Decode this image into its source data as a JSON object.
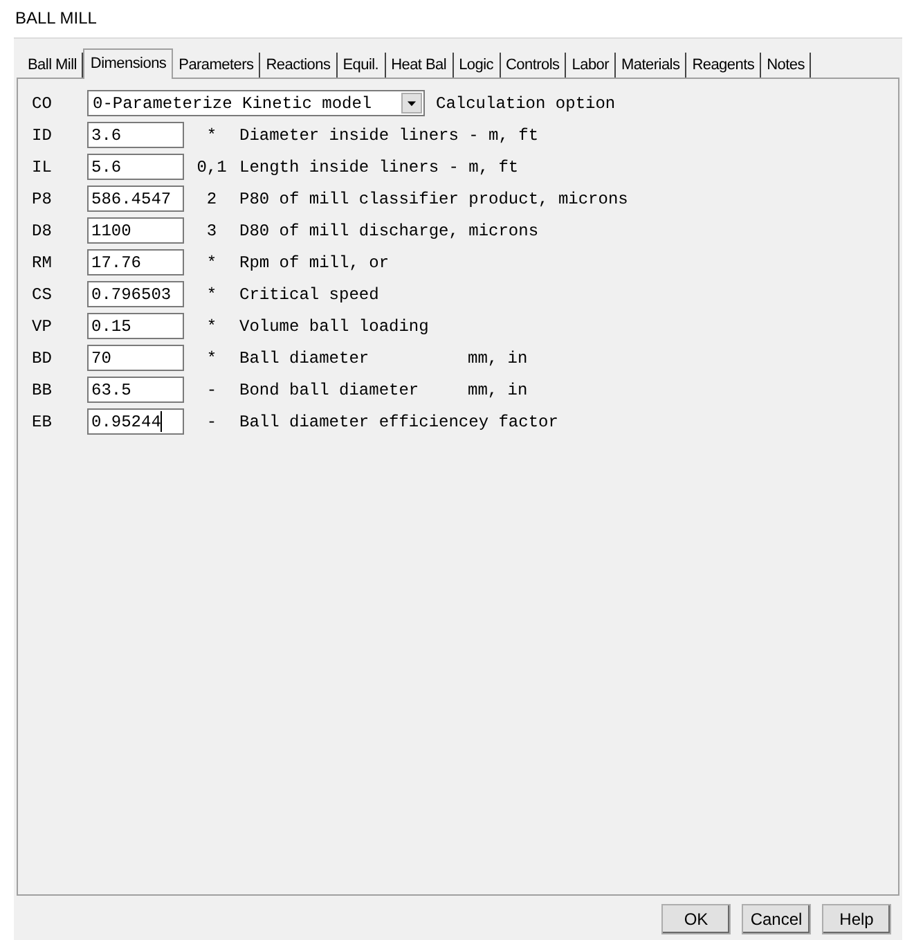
{
  "window": {
    "title": "BALL MILL"
  },
  "tabs": [
    {
      "label": "Ball Mill",
      "selected": false
    },
    {
      "label": "Dimensions",
      "selected": true
    },
    {
      "label": "Parameters",
      "selected": false
    },
    {
      "label": "Reactions",
      "selected": false
    },
    {
      "label": "Equil.",
      "selected": false
    },
    {
      "label": "Heat Bal",
      "selected": false
    },
    {
      "label": "Logic",
      "selected": false
    },
    {
      "label": "Controls",
      "selected": false
    },
    {
      "label": "Labor",
      "selected": false
    },
    {
      "label": "Materials",
      "selected": false
    },
    {
      "label": "Reagents",
      "selected": false
    },
    {
      "label": "Notes",
      "selected": false
    }
  ],
  "rows": [
    {
      "kind": "dropdown",
      "code": "CO",
      "value": "0-Parameterize Kinetic model",
      "description": "Calculation option"
    },
    {
      "kind": "field",
      "code": "ID",
      "value": "3.6",
      "marker": "*",
      "description": "Diameter inside liners - m, ft"
    },
    {
      "kind": "field",
      "code": "IL",
      "value": "5.6",
      "marker": "0,1",
      "description": "Length inside liners - m, ft"
    },
    {
      "kind": "field",
      "code": "P8",
      "value": "586.4547",
      "marker": "2",
      "description": "P80 of mill classifier product, microns"
    },
    {
      "kind": "field",
      "code": "D8",
      "value": "1100",
      "marker": "3",
      "description": "D80 of mill discharge, microns"
    },
    {
      "kind": "field",
      "code": "RM",
      "value": "17.76",
      "marker": "*",
      "description": "Rpm of mill, or"
    },
    {
      "kind": "field",
      "code": "CS",
      "value": "0.796503",
      "marker": "*",
      "description": "Critical speed"
    },
    {
      "kind": "field",
      "code": "VP",
      "value": "0.15",
      "marker": "*",
      "description": "Volume ball loading"
    },
    {
      "kind": "field",
      "code": "BD",
      "value": "70",
      "marker": "*",
      "description": "Ball diameter",
      "unit": "mm, in"
    },
    {
      "kind": "field",
      "code": "BB",
      "value": "63.5",
      "marker": "-",
      "description": "Bond ball diameter",
      "unit": "mm, in"
    },
    {
      "kind": "field",
      "code": "EB",
      "value": "0.95244",
      "marker": "-",
      "description": "Ball diameter efficiencey factor",
      "focused": true
    }
  ],
  "buttons": [
    "OK",
    "Cancel",
    "Help"
  ]
}
